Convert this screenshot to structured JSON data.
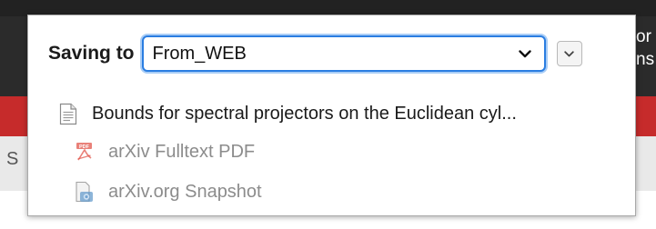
{
  "background": {
    "right_text_line1": "or",
    "right_text_line2": "ns",
    "left_text": "S"
  },
  "popup": {
    "saving_label": "Saving to",
    "collection_select": {
      "value": "From_WEB",
      "chevron_icon": "chevron-down-icon"
    },
    "expand_button_icon": "chevron-down-icon",
    "item": {
      "title": "Bounds for spectral projectors on the Euclidean cyl...",
      "icon": "document-icon"
    },
    "attachments": [
      {
        "label": "arXiv Fulltext PDF",
        "icon": "pdf-icon"
      },
      {
        "label": "arXiv.org Snapshot",
        "icon": "snapshot-icon"
      }
    ]
  },
  "colors": {
    "focus_border": "#2a7de1",
    "background_red": "#c62b2b",
    "muted_text": "#8c8c8c"
  }
}
